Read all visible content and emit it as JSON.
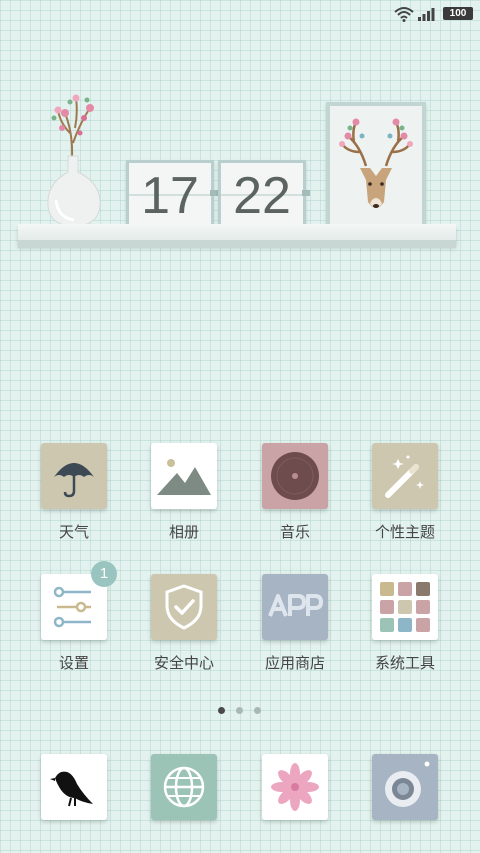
{
  "status_bar": {
    "wifi_icon": "wifi-icon",
    "signal_icon": "cell-signal-icon",
    "battery_level": "100"
  },
  "clock_widget": {
    "hour": "17",
    "minute": "22"
  },
  "apps": [
    {
      "label": "天气",
      "icon": "umbrella-icon",
      "color": "#cdc7b0"
    },
    {
      "label": "相册",
      "icon": "mountain-photo-icon",
      "color": "#ffffff"
    },
    {
      "label": "音乐",
      "icon": "vinyl-record-icon",
      "color": "#c9a3a5"
    },
    {
      "label": "个性主题",
      "icon": "magic-wand-icon",
      "color": "#cdc7b0"
    },
    {
      "label": "设置",
      "icon": "sliders-icon",
      "color": "#ffffff",
      "badge": "1"
    },
    {
      "label": "安全中心",
      "icon": "shield-check-icon",
      "color": "#cdc7b0"
    },
    {
      "label": "应用商店",
      "icon": "app-store-icon",
      "color": "#a6b4c4"
    },
    {
      "label": "系统工具",
      "icon": "tools-grid-icon",
      "color": "#ffffff"
    }
  ],
  "page_indicator": {
    "total": 3,
    "active": 0
  },
  "dock": [
    {
      "icon": "bird-icon",
      "color": "#ffffff"
    },
    {
      "icon": "globe-icon",
      "color": "#9cc4b6"
    },
    {
      "icon": "flower-icon",
      "color": "#ffffff"
    },
    {
      "icon": "camera-icon",
      "color": "#a6b4c4"
    }
  ]
}
